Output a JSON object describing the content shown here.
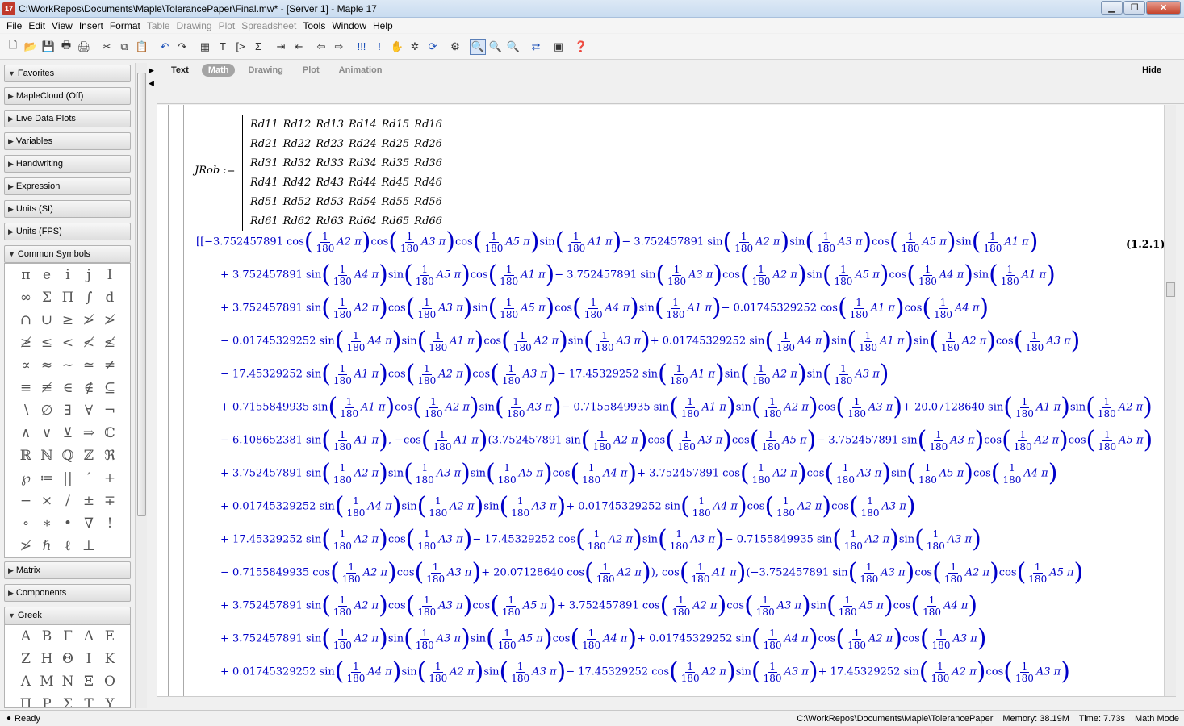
{
  "window": {
    "title": "C:\\WorkRepos\\Documents\\Maple\\TolerancePaper\\Final.mw* - [Server 1] - Maple 17",
    "app_icon_text": "17"
  },
  "menu": [
    "File",
    "Edit",
    "View",
    "Insert",
    "Format",
    "Table",
    "Drawing",
    "Plot",
    "Spreadsheet",
    "Tools",
    "Window",
    "Help"
  ],
  "menu_disabled": [
    "Table",
    "Drawing",
    "Plot",
    "Spreadsheet"
  ],
  "palettes": {
    "favorites": "Favorites",
    "maplecloud": "MapleCloud (Off)",
    "livedata": "Live Data Plots",
    "variables": "Variables",
    "handwriting": "Handwriting",
    "expression": "Expression",
    "units_si": "Units (SI)",
    "units_fps": "Units (FPS)",
    "common_symbols": "Common Symbols",
    "matrix": "Matrix",
    "components": "Components",
    "greek": "Greek"
  },
  "common_symbols": [
    "π",
    "e",
    "i",
    "j",
    "I",
    "∞",
    "Σ",
    "Π",
    "∫",
    "d",
    "∩",
    "∪",
    "≥",
    "≯",
    "≯",
    "≱",
    "≤",
    "<",
    "≮",
    "≰",
    "∝",
    "≈",
    "~",
    "≃",
    "≠",
    "≡",
    "≢",
    "∈",
    "∉",
    "⊆",
    "∖",
    "∅",
    "∃",
    "∀",
    "¬",
    "∧",
    "∨",
    "⊻",
    "⇒",
    "ℂ",
    "ℝ",
    "ℕ",
    "ℚ",
    "ℤ",
    "ℜ",
    "℘",
    "≔",
    "||",
    "′",
    "+",
    "−",
    "×",
    "/",
    "±",
    "∓",
    "∘",
    "∗",
    "•",
    "∇",
    "!",
    "≯",
    "ℏ",
    "ℓ",
    "⊥"
  ],
  "greek_symbols": [
    "Α",
    "Β",
    "Γ",
    "Δ",
    "Ε",
    "Ζ",
    "Η",
    "Θ",
    "Ι",
    "Κ",
    "Λ",
    "Μ",
    "Ν",
    "Ξ",
    "Ο",
    "Π",
    "Ρ",
    "Σ",
    "Τ",
    "Υ"
  ],
  "context_tabs": [
    "Text",
    "Math",
    "Drawing",
    "Plot",
    "Animation"
  ],
  "context_active": "Math",
  "hide_label": "Hide",
  "document": {
    "assign_lhs": "JRob :=",
    "matrix": [
      [
        "Rd11",
        "Rd12",
        "Rd13",
        "Rd14",
        "Rd15",
        "Rd16"
      ],
      [
        "Rd21",
        "Rd22",
        "Rd23",
        "Rd24",
        "Rd25",
        "Rd26"
      ],
      [
        "Rd31",
        "Rd32",
        "Rd33",
        "Rd34",
        "Rd35",
        "Rd36"
      ],
      [
        "Rd41",
        "Rd42",
        "Rd43",
        "Rd44",
        "Rd45",
        "Rd46"
      ],
      [
        "Rd51",
        "Rd52",
        "Rd53",
        "Rd54",
        "Rd55",
        "Rd56"
      ],
      [
        "Rd61",
        "Rd62",
        "Rd63",
        "Rd64",
        "Rd65",
        "Rd66"
      ]
    ],
    "equation_label": "(1.2.1)",
    "output_lines": [
      [
        [
          "t",
          "[[−3.752457891 cos"
        ],
        [
          "f",
          "A2 π"
        ],
        [
          "t",
          "cos"
        ],
        [
          "f",
          "A3 π"
        ],
        [
          "t",
          "cos"
        ],
        [
          "f",
          "A5 π"
        ],
        [
          "t",
          "sin"
        ],
        [
          "f",
          "A1 π"
        ],
        [
          "t",
          "− 3.752457891 sin"
        ],
        [
          "f",
          "A2 π"
        ],
        [
          "t",
          "sin"
        ],
        [
          "f",
          "A3 π"
        ],
        [
          "t",
          "cos"
        ],
        [
          "f",
          "A5 π"
        ],
        [
          "t",
          "sin"
        ],
        [
          "f",
          "A1 π"
        ]
      ],
      [
        [
          "t",
          "+ 3.752457891 sin"
        ],
        [
          "f",
          "A4 π"
        ],
        [
          "t",
          "sin"
        ],
        [
          "f",
          "A5 π"
        ],
        [
          "t",
          "cos"
        ],
        [
          "f",
          "A1 π"
        ],
        [
          "t",
          "− 3.752457891 sin"
        ],
        [
          "f",
          "A3 π"
        ],
        [
          "t",
          "cos"
        ],
        [
          "f",
          "A2 π"
        ],
        [
          "t",
          "sin"
        ],
        [
          "f",
          "A5 π"
        ],
        [
          "t",
          "cos"
        ],
        [
          "f",
          "A4 π"
        ],
        [
          "t",
          "sin"
        ],
        [
          "f",
          "A1 π"
        ]
      ],
      [
        [
          "t",
          "+ 3.752457891 sin"
        ],
        [
          "f",
          "A2 π"
        ],
        [
          "t",
          "cos"
        ],
        [
          "f",
          "A3 π"
        ],
        [
          "t",
          "sin"
        ],
        [
          "f",
          "A5 π"
        ],
        [
          "t",
          "cos"
        ],
        [
          "f",
          "A4 π"
        ],
        [
          "t",
          "sin"
        ],
        [
          "f",
          "A1 π"
        ],
        [
          "t",
          "− 0.01745329252 cos"
        ],
        [
          "f",
          "A1 π"
        ],
        [
          "t",
          "cos"
        ],
        [
          "f",
          "A4 π"
        ]
      ],
      [
        [
          "t",
          "− 0.01745329252 sin"
        ],
        [
          "f",
          "A4 π"
        ],
        [
          "t",
          "sin"
        ],
        [
          "f",
          "A1 π"
        ],
        [
          "t",
          "cos"
        ],
        [
          "f",
          "A2 π"
        ],
        [
          "t",
          "sin"
        ],
        [
          "f",
          "A3 π"
        ],
        [
          "t",
          "+ 0.01745329252 sin"
        ],
        [
          "f",
          "A4 π"
        ],
        [
          "t",
          "sin"
        ],
        [
          "f",
          "A1 π"
        ],
        [
          "t",
          "sin"
        ],
        [
          "f",
          "A2 π"
        ],
        [
          "t",
          "cos"
        ],
        [
          "f",
          "A3 π"
        ]
      ],
      [
        [
          "t",
          "− 17.45329252 sin"
        ],
        [
          "f",
          "A1 π"
        ],
        [
          "t",
          "cos"
        ],
        [
          "f",
          "A2 π"
        ],
        [
          "t",
          "cos"
        ],
        [
          "f",
          "A3 π"
        ],
        [
          "t",
          "− 17.45329252 sin"
        ],
        [
          "f",
          "A1 π"
        ],
        [
          "t",
          "sin"
        ],
        [
          "f",
          "A2 π"
        ],
        [
          "t",
          "sin"
        ],
        [
          "f",
          "A3 π"
        ]
      ],
      [
        [
          "t",
          "+ 0.7155849935 sin"
        ],
        [
          "f",
          "A1 π"
        ],
        [
          "t",
          "cos"
        ],
        [
          "f",
          "A2 π"
        ],
        [
          "t",
          "sin"
        ],
        [
          "f",
          "A3 π"
        ],
        [
          "t",
          "− 0.7155849935 sin"
        ],
        [
          "f",
          "A1 π"
        ],
        [
          "t",
          "sin"
        ],
        [
          "f",
          "A2 π"
        ],
        [
          "t",
          "cos"
        ],
        [
          "f",
          "A3 π"
        ],
        [
          "t",
          "+ 20.07128640 sin"
        ],
        [
          "f",
          "A1 π"
        ],
        [
          "t",
          "sin"
        ],
        [
          "f",
          "A2 π"
        ]
      ],
      [
        [
          "t",
          "− 6.108652381 sin"
        ],
        [
          "f",
          "A1 π"
        ],
        [
          "t",
          ", −cos"
        ],
        [
          "f",
          "A1 π"
        ],
        [
          "t",
          "(3.752457891 sin"
        ],
        [
          "f",
          "A2 π"
        ],
        [
          "t",
          "cos"
        ],
        [
          "f",
          "A3 π"
        ],
        [
          "t",
          "cos"
        ],
        [
          "f",
          "A5 π"
        ],
        [
          "t",
          "− 3.752457891 sin"
        ],
        [
          "f",
          "A3 π"
        ],
        [
          "t",
          "cos"
        ],
        [
          "f",
          "A2 π"
        ],
        [
          "t",
          "cos"
        ],
        [
          "f",
          "A5 π"
        ]
      ],
      [
        [
          "t",
          "+ 3.752457891 sin"
        ],
        [
          "f",
          "A2 π"
        ],
        [
          "t",
          "sin"
        ],
        [
          "f",
          "A3 π"
        ],
        [
          "t",
          "sin"
        ],
        [
          "f",
          "A5 π"
        ],
        [
          "t",
          "cos"
        ],
        [
          "f",
          "A4 π"
        ],
        [
          "t",
          "+ 3.752457891 cos"
        ],
        [
          "f",
          "A2 π"
        ],
        [
          "t",
          "cos"
        ],
        [
          "f",
          "A3 π"
        ],
        [
          "t",
          "sin"
        ],
        [
          "f",
          "A5 π"
        ],
        [
          "t",
          "cos"
        ],
        [
          "f",
          "A4 π"
        ]
      ],
      [
        [
          "t",
          "+ 0.01745329252 sin"
        ],
        [
          "f",
          "A4 π"
        ],
        [
          "t",
          "sin"
        ],
        [
          "f",
          "A2 π"
        ],
        [
          "t",
          "sin"
        ],
        [
          "f",
          "A3 π"
        ],
        [
          "t",
          "+ 0.01745329252 sin"
        ],
        [
          "f",
          "A4 π"
        ],
        [
          "t",
          "cos"
        ],
        [
          "f",
          "A2 π"
        ],
        [
          "t",
          "cos"
        ],
        [
          "f",
          "A3 π"
        ]
      ],
      [
        [
          "t",
          "+ 17.45329252 sin"
        ],
        [
          "f",
          "A2 π"
        ],
        [
          "t",
          "cos"
        ],
        [
          "f",
          "A3 π"
        ],
        [
          "t",
          "− 17.45329252 cos"
        ],
        [
          "f",
          "A2 π"
        ],
        [
          "t",
          "sin"
        ],
        [
          "f",
          "A3 π"
        ],
        [
          "t",
          "− 0.7155849935 sin"
        ],
        [
          "f",
          "A2 π"
        ],
        [
          "t",
          "sin"
        ],
        [
          "f",
          "A3 π"
        ]
      ],
      [
        [
          "t",
          "− 0.7155849935 cos"
        ],
        [
          "f",
          "A2 π"
        ],
        [
          "t",
          "cos"
        ],
        [
          "f",
          "A3 π"
        ],
        [
          "t",
          "+ 20.07128640 cos"
        ],
        [
          "f",
          "A2 π"
        ],
        [
          "t",
          "), cos"
        ],
        [
          "f",
          "A1 π"
        ],
        [
          "t",
          "(−3.752457891 sin"
        ],
        [
          "f",
          "A3 π"
        ],
        [
          "t",
          "cos"
        ],
        [
          "f",
          "A2 π"
        ],
        [
          "t",
          "cos"
        ],
        [
          "f",
          "A5 π"
        ]
      ],
      [
        [
          "t",
          "+ 3.752457891 sin"
        ],
        [
          "f",
          "A2 π"
        ],
        [
          "t",
          "cos"
        ],
        [
          "f",
          "A3 π"
        ],
        [
          "t",
          "cos"
        ],
        [
          "f",
          "A5 π"
        ],
        [
          "t",
          "+ 3.752457891 cos"
        ],
        [
          "f",
          "A2 π"
        ],
        [
          "t",
          "cos"
        ],
        [
          "f",
          "A3 π"
        ],
        [
          "t",
          "sin"
        ],
        [
          "f",
          "A5 π"
        ],
        [
          "t",
          "cos"
        ],
        [
          "f",
          "A4 π"
        ]
      ],
      [
        [
          "t",
          "+ 3.752457891 sin"
        ],
        [
          "f",
          "A2 π"
        ],
        [
          "t",
          "sin"
        ],
        [
          "f",
          "A3 π"
        ],
        [
          "t",
          "sin"
        ],
        [
          "f",
          "A5 π"
        ],
        [
          "t",
          "cos"
        ],
        [
          "f",
          "A4 π"
        ],
        [
          "t",
          "+ 0.01745329252 sin"
        ],
        [
          "f",
          "A4 π"
        ],
        [
          "t",
          "cos"
        ],
        [
          "f",
          "A2 π"
        ],
        [
          "t",
          "cos"
        ],
        [
          "f",
          "A3 π"
        ]
      ],
      [
        [
          "t",
          "+ 0.01745329252 sin"
        ],
        [
          "f",
          "A4 π"
        ],
        [
          "t",
          "sin"
        ],
        [
          "f",
          "A2 π"
        ],
        [
          "t",
          "sin"
        ],
        [
          "f",
          "A3 π"
        ],
        [
          "t",
          "− 17.45329252 cos"
        ],
        [
          "f",
          "A2 π"
        ],
        [
          "t",
          "sin"
        ],
        [
          "f",
          "A3 π"
        ],
        [
          "t",
          "+ 17.45329252 sin"
        ],
        [
          "f",
          "A2 π"
        ],
        [
          "t",
          "cos"
        ],
        [
          "f",
          "A3 π"
        ]
      ]
    ],
    "frac_num": "1",
    "frac_den": "180"
  },
  "status": {
    "state": "Ready",
    "path": "C:\\WorkRepos\\Documents\\Maple\\TolerancePaper",
    "memory": "Memory: 38.19M",
    "time": "Time: 7.73s",
    "mode": "Math Mode"
  }
}
